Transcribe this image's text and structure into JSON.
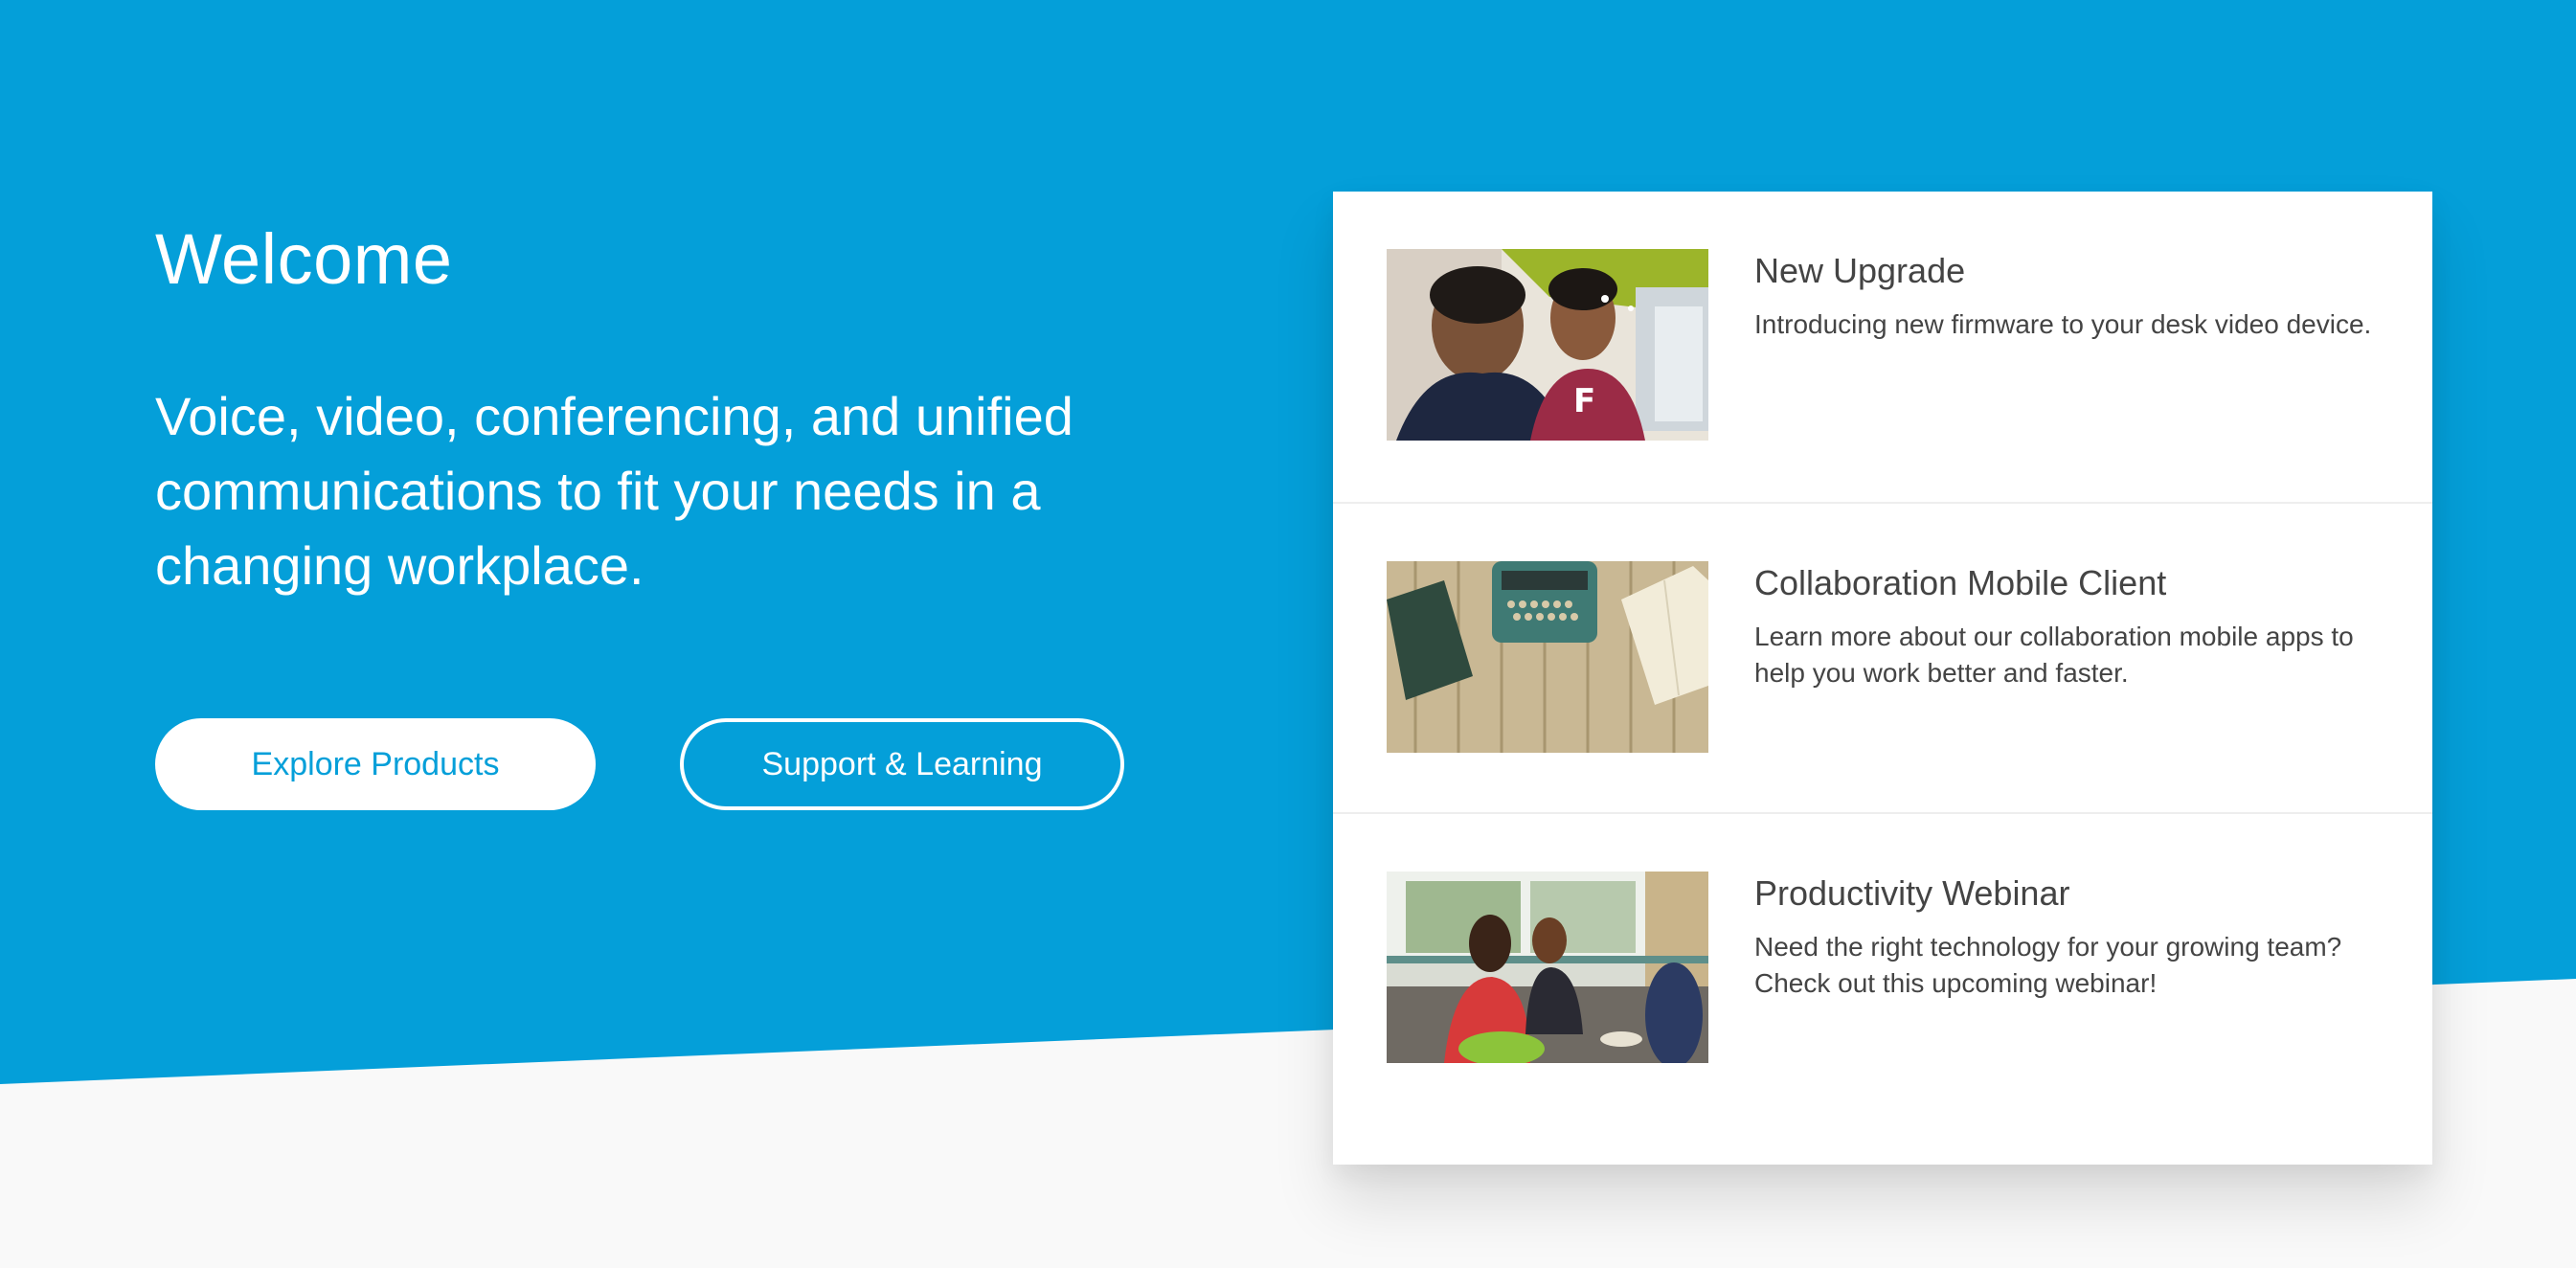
{
  "colors": {
    "brand_blue": "#049fd9",
    "background_light": "#f9f9f9",
    "card_background": "#ffffff",
    "text_dark": "#444444"
  },
  "hero": {
    "title": "Welcome",
    "tagline": "Voice, video, conferencing, and unified communications to fit your needs in a changing workplace.",
    "buttons": {
      "explore_label": "Explore Products",
      "support_label": "Support & Learning"
    }
  },
  "cards": [
    {
      "title": "New Upgrade",
      "description": "Introducing new firmware to your desk video device.",
      "image": "two-men-at-computer-photo"
    },
    {
      "title": "Collaboration Mobile Client",
      "description": "Learn more about our collaboration mobile apps to help you work better and faster.",
      "image": "typewriter-on-desk-photo"
    },
    {
      "title": "Productivity Webinar",
      "description": "Need the right technology for your growing team? Check out this upcoming webinar!",
      "image": "women-meeting-photo"
    }
  ]
}
